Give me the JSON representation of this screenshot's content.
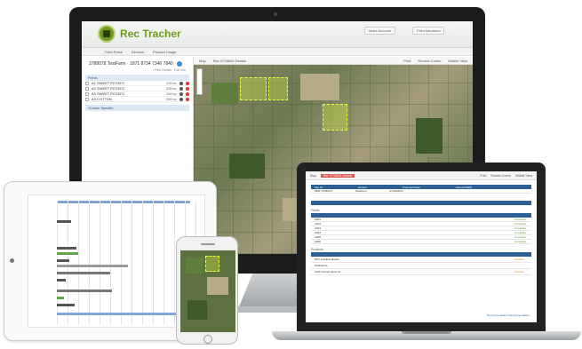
{
  "monitor_app": {
    "brand": "Rec Tracher",
    "account_buttons": [
      "Make Account",
      "Field Members"
    ],
    "nav": [
      "Field Rows",
      "Devices",
      "Product Usage"
    ],
    "farm_header": "3788078 TestFarm · 1871 8734 7346 7840",
    "sidebar_sub": "Field Details · Edit Info",
    "section_fields": "Fields",
    "section_other": "Grower Specific",
    "field_rows": [
      {
        "name": "A1 SWEET POTATO",
        "amount": "35ft/ac"
      },
      {
        "name": "A2 SWEET POTATO",
        "amount": "35ft/ac"
      },
      {
        "name": "A3 SWEET POTATO",
        "amount": "35ft/ac"
      },
      {
        "name": "A4 COTTON",
        "amount": "35ft/ac"
      }
    ],
    "map_toolbar": [
      "Map",
      "Rec 07/08/04 Details",
      "Print",
      "Review Comm",
      "Mobile View"
    ]
  },
  "laptop_app": {
    "toolbar": [
      "Map",
      "Rec 07/08/04 Details",
      "Print",
      "Review Comm",
      "Mobile View"
    ],
    "header_band": [
      "Site ID",
      "Grower",
      "Proposed Date",
      "Farm/ACRES",
      "PEST"
    ],
    "header_row": [
      "2801 TOMATO",
      "TestFarm",
      "07/18/2014",
      "",
      ""
    ],
    "fields_label": "Fields",
    "field_rows": [
      "A001",
      "A002",
      "A003",
      "A004",
      "A005",
      "A006"
    ],
    "complete_label": "Complete",
    "products_label": "Products",
    "product_rows": [
      "PHT Fertilizer Banter",
      "2045 Extra",
      "3245 Tomato Ilevel 97"
    ],
    "warning_label": "Pending",
    "link": "Recommendation Recommendation"
  },
  "colors": {
    "brand_green": "#6f9a1e",
    "header_blue": "#2f5f97",
    "complete_green": "#5a9a2a"
  }
}
